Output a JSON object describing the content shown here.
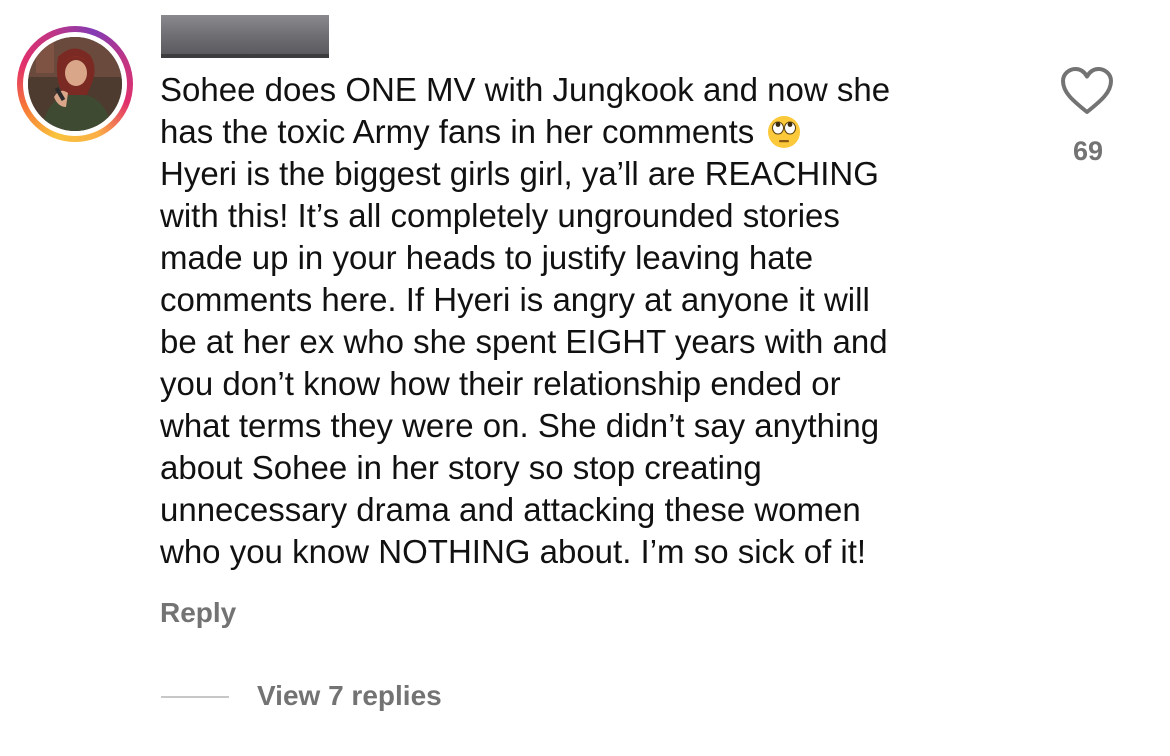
{
  "comment": {
    "lines": [
      "Sohee does ONE MV with Jungkook and now she",
      "has the toxic Army fans in her comments",
      "Hyeri is the biggest girls girl, ya’ll are REACHING",
      "with this! It’s all completely ungrounded stories",
      "made up in your heads to justify leaving hate",
      "comments here. If Hyeri is angry at anyone it will",
      "be at her ex who she spent EIGHT years with and",
      "you don’t know how their relationship ended or",
      "what terms they were on. She didn’t say anything",
      "about Sohee in her story so stop creating",
      "unnecessary drama and attacking these women",
      "who you know NOTHING about. I’m so sick of it!"
    ],
    "emoji": "face-with-rolling-eyes-emoji",
    "like_count": "69",
    "reply_label": "Reply",
    "view_replies_label": "View 7 replies"
  },
  "icons": {
    "like": "heart-outline-icon",
    "avatar": "user-avatar-illustration"
  },
  "colors": {
    "text": "#111111",
    "secondary_text": "#737373",
    "divider": "#c7c7c7",
    "redaction": "#6d6d72"
  }
}
